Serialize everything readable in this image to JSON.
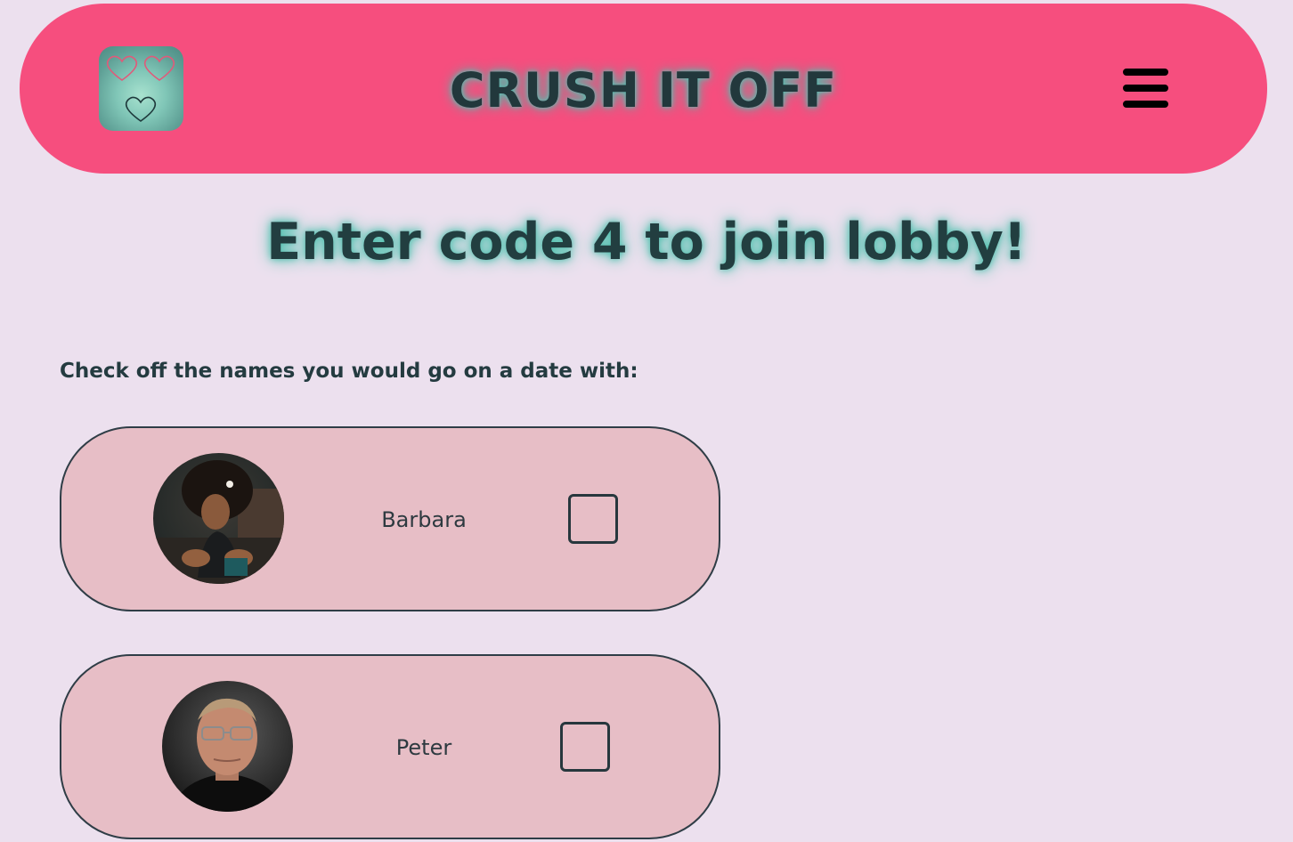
{
  "header": {
    "title": "CRUSH IT OFF",
    "logo_icon": "hearts-logo-icon",
    "menu_icon": "hamburger-menu-icon"
  },
  "lobby": {
    "heading": "Enter code 4 to join lobby!"
  },
  "instructions": "Check off the names you would go on a date with:",
  "people": [
    {
      "name": "Barbara",
      "checked": false
    },
    {
      "name": "Peter",
      "checked": false
    }
  ],
  "colors": {
    "background": "#ece0ee",
    "header": "#f64e7e",
    "card": "#e7bec6",
    "text": "#233a40",
    "glow": "#4ec0ae"
  }
}
